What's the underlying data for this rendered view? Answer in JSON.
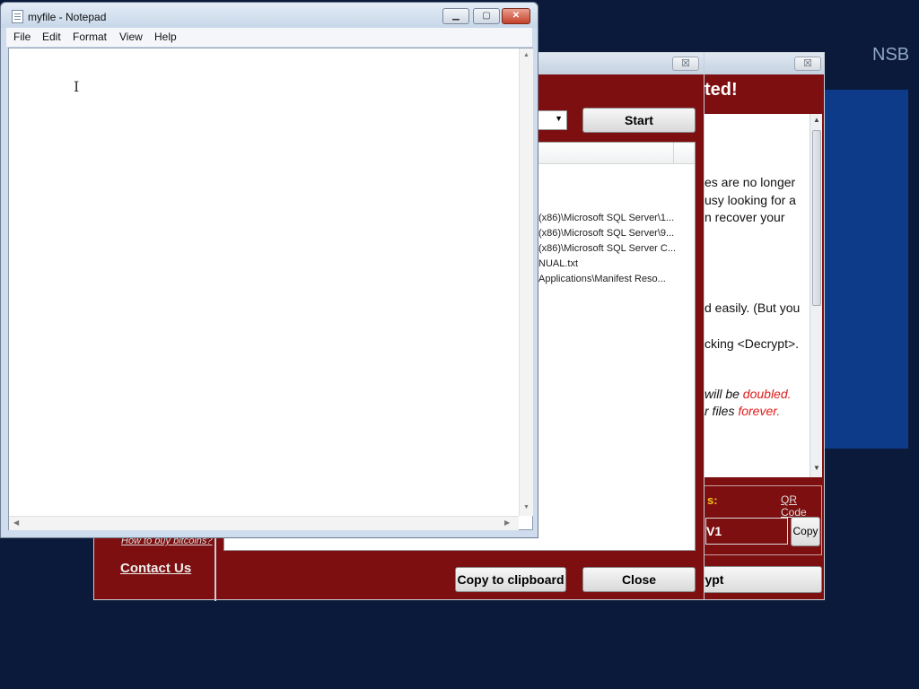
{
  "desktop": {
    "label": "NSB"
  },
  "wannacry_main": {
    "close_glyph": "☒",
    "heading_fragment": "ted!",
    "text_lines": [
      {
        "text": "es are no longer"
      },
      {
        "text": "usy looking for a"
      },
      {
        "text": "n recover your"
      },
      {
        "text": "d easily. (But you"
      },
      {
        "text": "cking <Decrypt>."
      }
    ],
    "doubled_line": {
      "prefix": " will be ",
      "red": "doubled",
      "suffix": "."
    },
    "forever_line": {
      "prefix": "r files ",
      "red": "forever",
      "suffix": "."
    },
    "send_label": "s:",
    "qr_link": "QR Code",
    "address_fragment": "V1",
    "copy_button": "Copy",
    "decrypt_button": "rypt",
    "how_to_buy": "How to buy bitcoins?",
    "contact_us": "Contact Us",
    "colors": {
      "background": "#7d0f10",
      "send_label": "#f5c518",
      "warning": "#e01b1b"
    }
  },
  "decrypt_dialog": {
    "close_glyph": "☒",
    "start_button": "Start",
    "file_rows": [
      "(x86)\\Microsoft SQL Server\\1...",
      "(x86)\\Microsoft SQL Server\\9...",
      "(x86)\\Microsoft SQL Server C...",
      "NUAL.txt",
      "Applications\\Manifest Reso..."
    ],
    "copy_to_clipboard": "Copy to clipboard",
    "close_button": "Close"
  },
  "notepad": {
    "title": "myfile - Notepad",
    "menu": [
      "File",
      "Edit",
      "Format",
      "View",
      "Help"
    ],
    "minimize_glyph": "▁",
    "maximize_glyph": "▢",
    "close_glyph": "✕",
    "text": ""
  }
}
